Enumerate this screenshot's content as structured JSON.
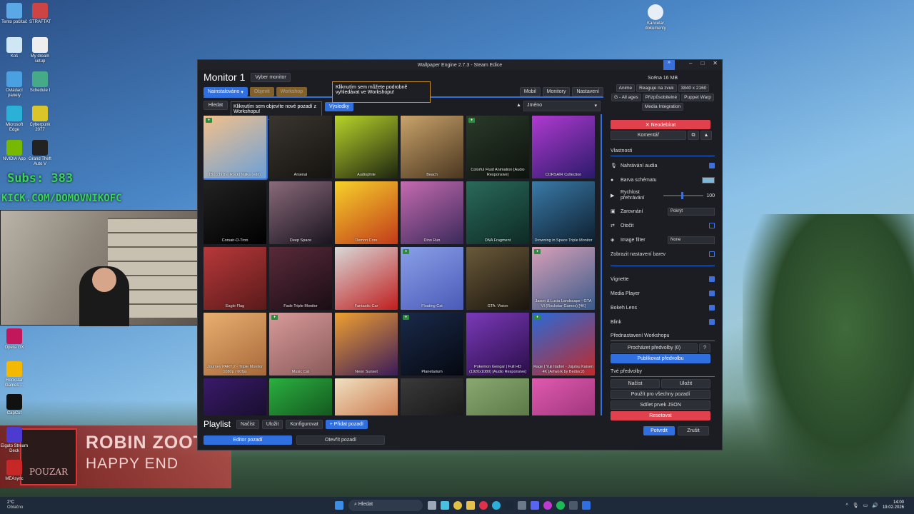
{
  "desktop": {
    "icons": [
      {
        "label": "Tento počítač",
        "color": "#5aa9e6"
      },
      {
        "label": "STRAFTAT",
        "color": "#c44"
      },
      {
        "label": "Koš",
        "color": "#cfe6f5"
      },
      {
        "label": "My dream setup",
        "color": "#eee"
      },
      {
        "label": "Ovládací panely",
        "color": "#4aa0e0"
      },
      {
        "label": "Schedule I",
        "color": "#4a8"
      },
      {
        "label": "Microsoft Edge",
        "color": "#2bb0d8"
      },
      {
        "label": "Cyberpunk 2077",
        "color": "#d9c52a"
      },
      {
        "label": "NVIDIA App",
        "color": "#76b900"
      },
      {
        "label": "Grand Theft Auto V",
        "color": "#222"
      }
    ],
    "left_icons2": [
      {
        "label": "Opera GX",
        "color": "#c2185b"
      },
      {
        "label": "Rockstar Games ...",
        "color": "#f5b800"
      },
      {
        "label": "CapCut",
        "color": "#111"
      },
      {
        "label": "Elgato Stream Deck",
        "color": "#4d3bd1"
      },
      {
        "label": "MEAsync",
        "color": "#c62828"
      }
    ],
    "topright_icon": "Kancelar dokumenty"
  },
  "overlay": {
    "subs_text": "Subs: 383",
    "kick_text": "KICK.COM/DOMOVNIKOFC",
    "song_title": "ROBIN ZOOT",
    "song_subtitle": "HAPPY END",
    "album_text": "POUZAR"
  },
  "window": {
    "title": "Wallpaper Engine 2.7.3 - Steam Edice",
    "monitor_title": "Monitor 1",
    "select_monitor": "Vyber monitor",
    "tabs": {
      "installed": "Nainstalováno",
      "discover": "Objevit",
      "workshop": "Workshop"
    },
    "right_tabs": {
      "mobile": "Mobil",
      "monitors": "Monitory",
      "settings": "Nastavení"
    },
    "search_label": "Hledat",
    "results_label": "Výsledky",
    "sort_value": "Jméno",
    "tooltip_discover": "Kliknutím sem objevíte nové pozadí z Workshopu!",
    "tooltip_workshop": "Kliknutím sem můžete podrobně vyhledávat ve Workshopu!",
    "tiles": [
      {
        "name": "[Bocchi the Rock] Nijika (edit)",
        "c1": "#f3c08a",
        "c2": "#6ca0d8",
        "gift": true
      },
      {
        "name": "Arsenal",
        "c1": "#3a3530",
        "c2": "#15130f",
        "gift": false
      },
      {
        "name": "Audiophile",
        "c1": "#b7d42a",
        "c2": "#1d2410",
        "gift": false
      },
      {
        "name": "Beach",
        "c1": "#c9a36a",
        "c2": "#4a3620",
        "gift": false
      },
      {
        "name": "Colorful Fluid Animation [Audio Responsive]",
        "c1": "#2a3a2a",
        "c2": "#0d120d",
        "gift": true
      },
      {
        "name": "CORSAIR Collection",
        "c1": "#b03ad0",
        "c2": "#2a1a6a",
        "gift": false
      },
      {
        "name": "Corsair-O-Tron",
        "c1": "#222",
        "c2": "#000",
        "gift": false
      },
      {
        "name": "Deep Space",
        "c1": "#8a6a7a",
        "c2": "#1a1420",
        "gift": false
      },
      {
        "name": "Demon Core",
        "c1": "#f6d22a",
        "c2": "#c23a1a",
        "gift": false
      },
      {
        "name": "Dino Run",
        "c1": "#c66ab0",
        "c2": "#3a2a5a",
        "gift": false
      },
      {
        "name": "DNA Fragment",
        "c1": "#2a6a5a",
        "c2": "#0d2a24",
        "gift": false
      },
      {
        "name": "Drowning in Space Triple Monitor",
        "c1": "#3a7aa8",
        "c2": "#0d1e2e",
        "gift": false
      },
      {
        "name": "Eagle Flag",
        "c1": "#b8383a",
        "c2": "#5a1a1a",
        "gift": false
      },
      {
        "name": "Fade Triple Monitor",
        "c1": "#5a2a3a",
        "c2": "#1a0d14",
        "gift": false
      },
      {
        "name": "Fantastic Car",
        "c1": "#d8d8d8",
        "c2": "#c01e1e",
        "gift": false
      },
      {
        "name": "Floating Cat",
        "c1": "#8aa0e8",
        "c2": "#4a5ab8",
        "gift": true
      },
      {
        "name": "GTA: Vision",
        "c1": "#6a5a3a",
        "c2": "#1a140d",
        "gift": false
      },
      {
        "name": "Jason & Lucia Landscape - GTA VI (Rockstar Games) [4K]",
        "c1": "#d8a0b8",
        "c2": "#3a5a8a",
        "gift": true
      },
      {
        "name": "Journey PART 2 - Triple Monitor 1080p / 60fps",
        "c1": "#e8b070",
        "c2": "#a8683a",
        "gift": false
      },
      {
        "name": "Music Cat",
        "c1": "#d89a9a",
        "c2": "#8a5a5a",
        "gift": true
      },
      {
        "name": "Neon Sunset",
        "c1": "#f0a030",
        "c2": "#3a1a5a",
        "gift": false
      },
      {
        "name": "Planetarium",
        "c1": "#1a2a4a",
        "c2": "#050810",
        "gift": true
      },
      {
        "name": "Pokemon Gengar | Full HD (1920x1080) [Audio Responsive]",
        "c1": "#7a3ab8",
        "c2": "#2a0d4a",
        "gift": false
      },
      {
        "name": "Rage | Yuji Itadori - Jujutsu Kaisen 4K (Artwork by Bedioc2)",
        "c1": "#2a6ad8",
        "c2": "#c02a2a",
        "gift": true
      },
      {
        "name": "",
        "c1": "#3a1a6a",
        "c2": "#0d0a1a",
        "gift": false
      },
      {
        "name": "",
        "c1": "#2ab040",
        "c2": "#0d3a14",
        "gift": false
      },
      {
        "name": "",
        "c1": "#f0e0c0",
        "c2": "#c05a2a",
        "gift": false
      },
      {
        "name": "",
        "c1": "#3a3a3a",
        "c2": "#0d0d0d",
        "gift": false
      },
      {
        "name": "",
        "c1": "#8aa870",
        "c2": "#4a6a3a",
        "gift": false
      },
      {
        "name": "",
        "c1": "#e05ab0",
        "c2": "#8a2a6a",
        "gift": false
      }
    ],
    "playlist": {
      "title": "Playlist",
      "load": "Načíst",
      "save": "Uložit",
      "configure": "Konfigurovat",
      "add": "+ Přidat pozadí"
    },
    "bottom": {
      "editor": "Editor pozadí",
      "open": "Otevřít pozadí"
    },
    "panel": {
      "scene_size": "Scéna  16 MB",
      "tags": [
        "Anime",
        "Reaguje na zvuk",
        "3840 x 2160",
        "G - All ages",
        "Přizpůsobitelné",
        "Puppet Warp",
        "Media Integration"
      ],
      "unsubscribe": "✕ Neodebírat",
      "comment": "Komentář",
      "properties_title": "Vlastnosti",
      "audio_recording": "Nahrávání audia",
      "scheme_color": "Barva schématu",
      "playback_speed": "Rychlost přehrávání",
      "playback_value": "100",
      "alignment": "Zarovnání",
      "alignment_value": "Pokrýt",
      "rotate": "Otočit",
      "image_filter": "Image filter",
      "image_filter_value": "None",
      "show_color_settings": "Zobrazit nastavení barev",
      "vignette": "Vignette",
      "media_player": "Media Player",
      "bokeh": "Bokeh Lens",
      "blink": "Blink",
      "workshop_presets_title": "Přednastavení Workshopu",
      "browse_presets": "Procházet předvolby (0)",
      "publish_preset": "Publikovat předvolbu",
      "your_presets_title": "Tvé předvolby",
      "load": "Načíst",
      "save": "Uložit",
      "use_all": "Použít pro všechny pozadí",
      "share_json": "Sdílet prvek JSON",
      "reset": "Resetovat",
      "confirm": "Potvrdit",
      "cancel": "Zrušit"
    }
  },
  "taskbar": {
    "weather_temp": "2°C",
    "weather_text": "Oblačno",
    "search_placeholder": "Hledat",
    "time": "14:00",
    "date": "19.02.2026"
  }
}
